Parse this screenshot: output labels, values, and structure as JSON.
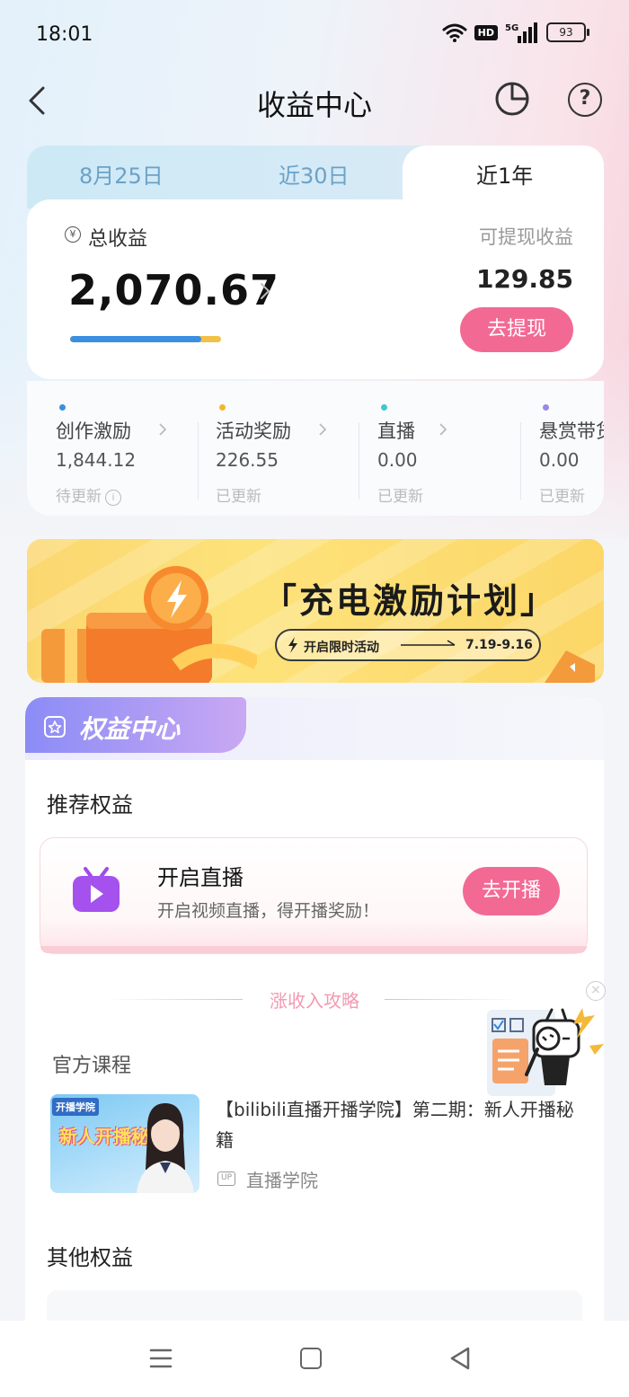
{
  "status_bar": {
    "time": "18:01",
    "network_badge": "HD",
    "signal_label": "5G",
    "battery": "93"
  },
  "header": {
    "title": "收益中心",
    "back_icon": "chevron-left-icon",
    "stats_icon": "pie-chart-icon",
    "help_icon": "help-circle-icon",
    "help_glyph": "?"
  },
  "tabs": [
    {
      "label": "8月25日",
      "active": false
    },
    {
      "label": "近30日",
      "active": false
    },
    {
      "label": "近1年",
      "active": true
    }
  ],
  "summary": {
    "yen_glyph": "¥",
    "total_label": "总收益",
    "total_value": "2,070.67",
    "withdrawable_label": "可提现收益",
    "withdrawable_value": "129.85",
    "withdraw_button": "去提现",
    "progress_fraction": 0.87
  },
  "breakdown": [
    {
      "label": "创作激励",
      "value": "1,844.12",
      "status": "待更新",
      "dot_color": "#3a8fe0",
      "info_glyph": "i"
    },
    {
      "label": "活动奖励",
      "value": "226.55",
      "status": "已更新",
      "dot_color": "#f2b632"
    },
    {
      "label": "直播",
      "value": "0.00",
      "status": "已更新",
      "dot_color": "#3cc8d0"
    },
    {
      "label": "悬赏带货",
      "value": "0.00",
      "status": "已更新",
      "dot_color": "#9b86e8"
    }
  ],
  "banner": {
    "title": "「充电激励计划」",
    "pill_text": "开启限时活动",
    "pill_dates": "7.19-9.16"
  },
  "rights_center": {
    "title": "权益中心",
    "recommended_label": "推荐权益",
    "recommended": {
      "title": "开启直播",
      "subtitle": "开启视频直播，得开播奖励！",
      "button": "去开播"
    },
    "strategy_label": "涨收入攻略",
    "course_section_label": "官方课程",
    "course": {
      "thumb_badge": "开播学院",
      "thumb_text": "新人开播秘籍",
      "title": "【bilibili直播开播学院】第二期：新人开播秘籍",
      "up_badge": "UP",
      "author": "直播学院"
    },
    "other_label": "其他权益"
  },
  "floating": {
    "close_glyph": "×",
    "mascot_icon": "tv-mascot-magnifier-icon"
  },
  "colors": {
    "accent_pink": "#f26a93",
    "progress_blue": "#3a8fe0",
    "progress_yellow": "#f2c14a",
    "rights_purple": "#8b8cf6"
  }
}
